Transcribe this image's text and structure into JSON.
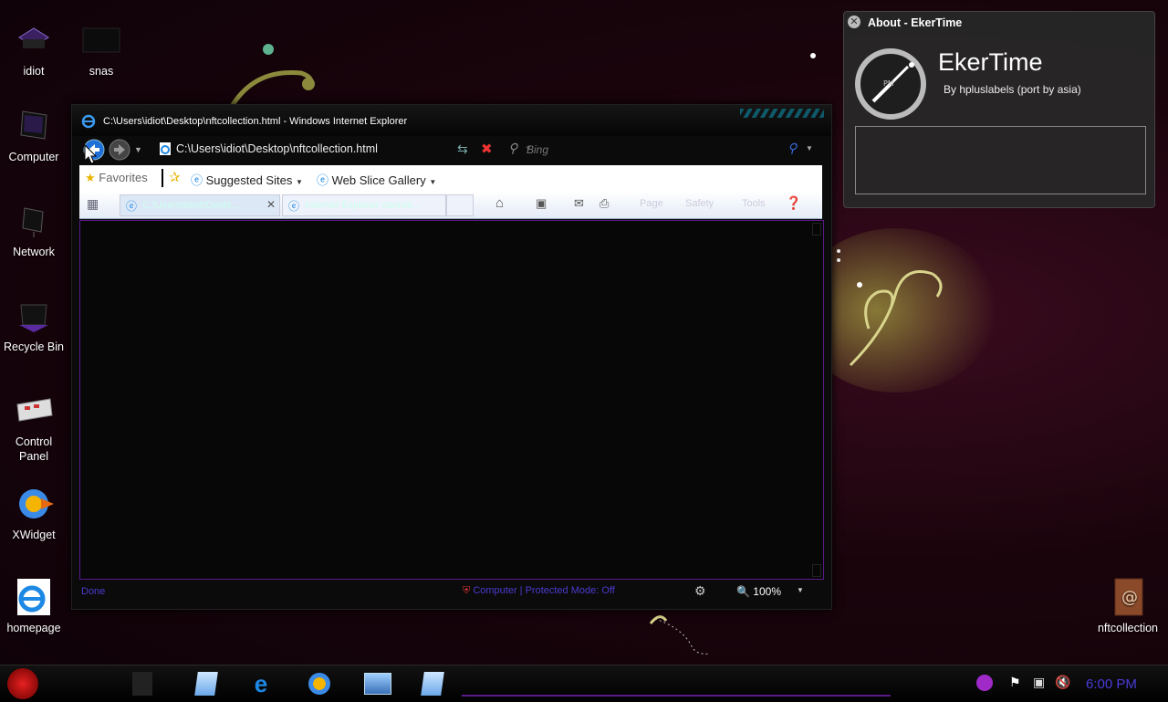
{
  "desktop": {
    "icons": [
      {
        "id": "idiot",
        "label": "idiot"
      },
      {
        "id": "snas",
        "label": "snas"
      },
      {
        "id": "computer",
        "label": "Computer"
      },
      {
        "id": "network",
        "label": "Network"
      },
      {
        "id": "recycle",
        "label": "Recycle Bin"
      },
      {
        "id": "control",
        "label": "Control Panel"
      },
      {
        "id": "xwidget",
        "label": "XWidget"
      },
      {
        "id": "homepage",
        "label": "homepage"
      },
      {
        "id": "nftcollection",
        "label": "nftcollection"
      }
    ]
  },
  "ie": {
    "title": "C:\\Users\\idiot\\Desktop\\nftcollection.html - Windows Internet Explorer",
    "address": "C:\\Users\\idiot\\Desktop\\nftcollection.html",
    "search_placeholder": "Bing",
    "favorites_label": "Favorites",
    "suggested_sites": "Suggested Sites",
    "web_slice_gallery": "Web Slice Gallery",
    "tabs": [
      {
        "label": "C:\\Users\\idiot\\Deskt..."
      },
      {
        "label": "Internet Explorer cannot..."
      }
    ],
    "cmd": {
      "page": "Page",
      "safety": "Safety",
      "tools": "Tools"
    },
    "status": {
      "left": "Done",
      "zone": "Computer | Protected Mode: Off",
      "zoom": "100%"
    }
  },
  "about": {
    "window_title": "About - EkerTime",
    "app_name": "EkerTime",
    "byline": "By hpluslabels (port by asia)",
    "clock_label": "PM"
  },
  "taskbar": {
    "clock": "6:00 PM"
  },
  "colors": {
    "accent_purple": "#6a2fd8",
    "status_text": "#4b3bd0",
    "clock_text": "#4a3cd8"
  }
}
